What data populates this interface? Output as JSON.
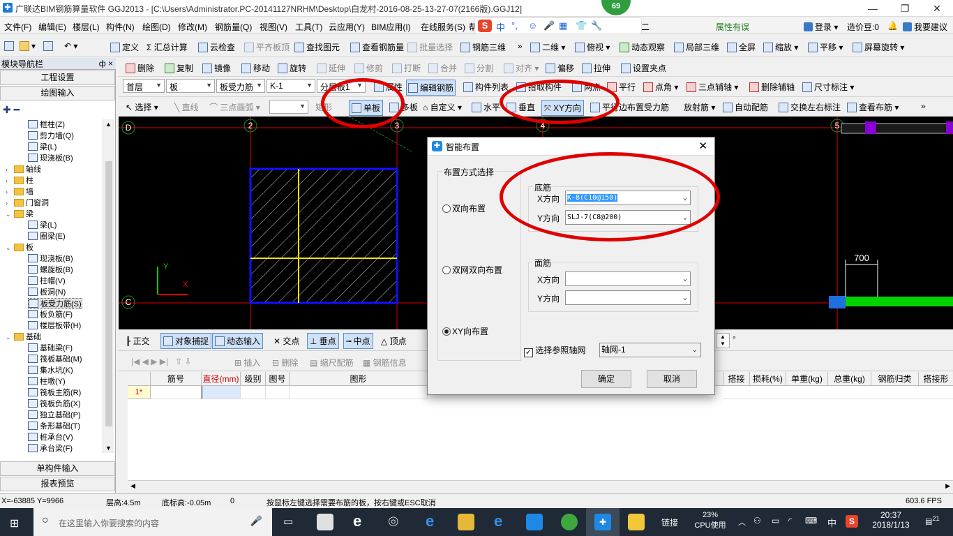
{
  "window": {
    "title": "广联达BIM钢筋算量软件 GGJ2013 - [C:\\Users\\Administrator.PC-20141127NRHM\\Desktop\\白龙村-2016-08-25-13-27-07(2166版).GGJ12]",
    "badge": "69"
  },
  "menu": {
    "items": [
      "文件(F)",
      "编辑(E)",
      "楼层(L)",
      "构件(N)",
      "绘图(D)",
      "修改(M)",
      "钢筋量(Q)",
      "视图(V)",
      "工具(T)",
      "云应用(Y)",
      "BIM应用(I)",
      "在线服务(S)",
      "帮"
    ],
    "ime": [
      "中",
      "°,",
      "☺",
      "🎤",
      "▦",
      "👕",
      "🔧"
    ],
    "right": {
      "assistant": "广小二",
      "property": "属性有误",
      "login": "登录",
      "price": "造价豆:0",
      "suggest": "我要建议"
    }
  },
  "toolbar1": {
    "items": [
      "定义",
      "Σ 汇总计算",
      "云检查",
      "平齐板顶",
      "查找图元",
      "查看钢筋量",
      "批量选择",
      "钢筋三维",
      "二维",
      "俯视",
      "动态观察",
      "局部三维",
      "全屏",
      "缩放",
      "平移",
      "屏幕旋转"
    ]
  },
  "toolbar2": {
    "items": [
      "删除",
      "复制",
      "镜像",
      "移动",
      "旋转",
      "延伸",
      "修剪",
      "打断",
      "合并",
      "分割",
      "对齐",
      "偏移",
      "拉伸",
      "设置夹点"
    ]
  },
  "toolbar3": {
    "floor": "首层",
    "category": "板",
    "type": "板受力筋",
    "name": "K-1",
    "layer": "分层板1",
    "items": [
      "属性",
      "编辑钢筋",
      "构件列表",
      "拾取构件",
      "两点",
      "平行",
      "点角",
      "三点辅轴",
      "删除辅轴",
      "尺寸标注"
    ]
  },
  "toolbar4": {
    "items": [
      "选择",
      "直线",
      "三点画弧",
      "矩形",
      "单板",
      "多板",
      "自定义",
      "水平",
      "垂直",
      "XY方向",
      "平行边布置受力筋",
      "放射筋",
      "自动配筋",
      "交换左右标注",
      "查看布筋"
    ]
  },
  "nav": {
    "title": "模块导航栏",
    "pin": "ф ×",
    "top_buttons": [
      "工程设置",
      "绘图输入"
    ],
    "bottom_buttons": [
      "单构件输入",
      "报表预览"
    ],
    "tree": [
      {
        "label": "框柱(Z)",
        "indent": 2,
        "folder": false,
        "exp": ""
      },
      {
        "label": "剪力墙(Q)",
        "indent": 2,
        "folder": false,
        "exp": ""
      },
      {
        "label": "梁(L)",
        "indent": 2,
        "folder": false,
        "exp": ""
      },
      {
        "label": "现浇板(B)",
        "indent": 2,
        "folder": false,
        "exp": ""
      },
      {
        "label": "轴线",
        "indent": 1,
        "folder": true,
        "exp": "›"
      },
      {
        "label": "柱",
        "indent": 1,
        "folder": true,
        "exp": "›"
      },
      {
        "label": "墙",
        "indent": 1,
        "folder": true,
        "exp": "›"
      },
      {
        "label": "门窗洞",
        "indent": 1,
        "folder": true,
        "exp": "›"
      },
      {
        "label": "梁",
        "indent": 1,
        "folder": true,
        "exp": "⌄"
      },
      {
        "label": "梁(L)",
        "indent": 2,
        "folder": false,
        "exp": ""
      },
      {
        "label": "圈梁(E)",
        "indent": 2,
        "folder": false,
        "exp": ""
      },
      {
        "label": "板",
        "indent": 1,
        "folder": true,
        "exp": "⌄"
      },
      {
        "label": "现浇板(B)",
        "indent": 2,
        "folder": false,
        "exp": ""
      },
      {
        "label": "螺旋板(B)",
        "indent": 2,
        "folder": false,
        "exp": ""
      },
      {
        "label": "柱帽(V)",
        "indent": 2,
        "folder": false,
        "exp": ""
      },
      {
        "label": "板洞(N)",
        "indent": 2,
        "folder": false,
        "exp": ""
      },
      {
        "label": "板受力筋(S)",
        "indent": 2,
        "folder": false,
        "exp": "",
        "selected": true
      },
      {
        "label": "板负筋(F)",
        "indent": 2,
        "folder": false,
        "exp": ""
      },
      {
        "label": "楼层板带(H)",
        "indent": 2,
        "folder": false,
        "exp": ""
      },
      {
        "label": "基础",
        "indent": 1,
        "folder": true,
        "exp": "⌄"
      },
      {
        "label": "基础梁(F)",
        "indent": 2,
        "folder": false,
        "exp": ""
      },
      {
        "label": "筏板基础(M)",
        "indent": 2,
        "folder": false,
        "exp": ""
      },
      {
        "label": "集水坑(K)",
        "indent": 2,
        "folder": false,
        "exp": ""
      },
      {
        "label": "柱墩(Y)",
        "indent": 2,
        "folder": false,
        "exp": ""
      },
      {
        "label": "筏板主筋(R)",
        "indent": 2,
        "folder": false,
        "exp": ""
      },
      {
        "label": "筏板负筋(X)",
        "indent": 2,
        "folder": false,
        "exp": ""
      },
      {
        "label": "独立基础(P)",
        "indent": 2,
        "folder": false,
        "exp": ""
      },
      {
        "label": "条形基础(T)",
        "indent": 2,
        "folder": false,
        "exp": ""
      },
      {
        "label": "桩承台(V)",
        "indent": 2,
        "folder": false,
        "exp": ""
      },
      {
        "label": "承台梁(F)",
        "indent": 2,
        "folder": false,
        "exp": ""
      }
    ]
  },
  "canvas": {
    "axis_labels": [
      "D",
      "2",
      "3",
      "4",
      "5",
      "C"
    ],
    "dimension": "700",
    "ucs_y": "Y",
    "ucs_x": "X"
  },
  "bottombar": {
    "items": [
      "正交",
      "对象捕捉",
      "动态输入",
      "交点",
      "垂点",
      "中点",
      "顶点"
    ],
    "degree": "°"
  },
  "gridtb": {
    "items": [
      "插入",
      "删除",
      "缩尺配筋",
      "钢筋信息"
    ]
  },
  "table": {
    "headers": [
      "筋号",
      "直径(mm)",
      "级别",
      "图号",
      "图形",
      "",
      "搭接",
      "损耗(%)",
      "单重(kg)",
      "总重(kg)",
      "钢筋归类",
      "搭接形"
    ],
    "row_label": "1*"
  },
  "dialog": {
    "title": "智能布置",
    "layout_group": "布置方式选择",
    "options": [
      "双向布置",
      "双网双向布置",
      "XY向布置"
    ],
    "selected_option": 2,
    "bottom_group": "底筋",
    "top_group": "面筋",
    "x_label": "X方向",
    "y_label": "Y方向",
    "bottom_x": "K-8(C10@150)",
    "bottom_y": "SLJ-7(C8@200)",
    "top_x": "",
    "top_y": "",
    "ref_axis_label": "选择参照轴网",
    "ref_axis_value": "轴网-1",
    "ok": "确定",
    "cancel": "取消"
  },
  "status": {
    "coords": "X=-63885 Y=9966",
    "floor_height": "层高:4.5m",
    "base_height": "底标高:-0.05m",
    "zero": "0",
    "hint": "按鼠标左键选择需要布筋的板，按右键或ESC取消",
    "fps": "603.6 FPS"
  },
  "taskbar": {
    "search": "在这里输入你要搜索的内容",
    "link": "链接",
    "cpu_value": "23%",
    "cpu_label": "CPU使用",
    "ime": "中",
    "time": "20:37",
    "date": "2018/1/13",
    "notif": "21"
  },
  "colors": {
    "canvas_bg": "#000000",
    "axis_red": "#e00000",
    "slab_blue": "#1010ff",
    "rebar_yellow": "#f2e600",
    "axis_green": "#1e8a1e",
    "highlight_ring": "#e00000"
  }
}
